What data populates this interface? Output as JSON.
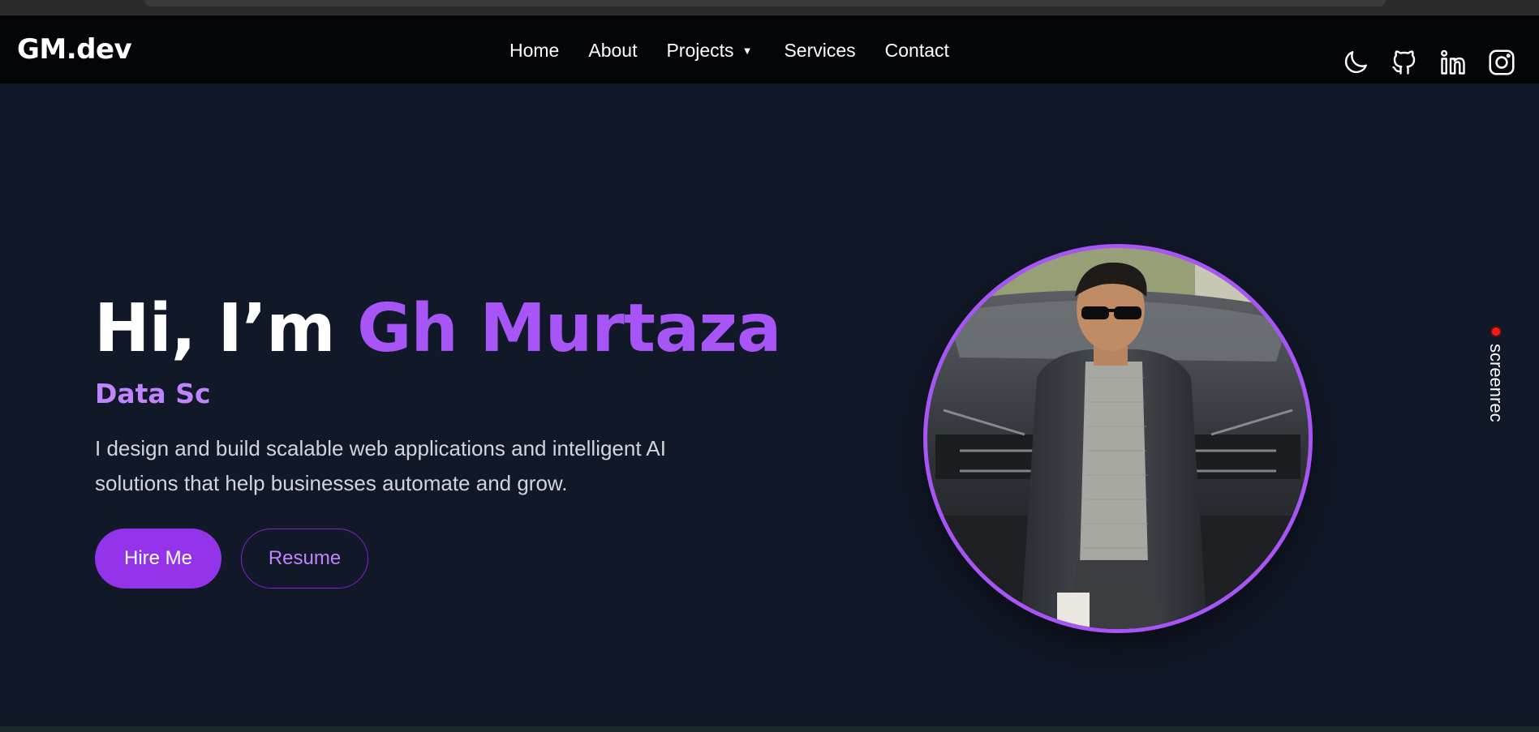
{
  "navbar": {
    "logo": "GM.dev",
    "links": [
      {
        "label": "Home"
      },
      {
        "label": "About"
      },
      {
        "label": "Projects",
        "has_dropdown": true,
        "caret": "▼"
      },
      {
        "label": "Services"
      },
      {
        "label": "Contact"
      }
    ],
    "icons": [
      "moon-icon",
      "github-icon",
      "linkedin-icon",
      "instagram-icon"
    ]
  },
  "hero": {
    "greeting": "Hi, I’m ",
    "name": "Gh Murtaza",
    "role": "Data Sc",
    "description": "I design and build scalable web applications and intelligent AI solutions that help businesses automate and grow.",
    "hire_label": "Hire Me",
    "resume_label": "Resume"
  },
  "overlay": {
    "screenrec_label": "screenrec"
  },
  "colors": {
    "background": "#111827",
    "navbar": "#030508",
    "accent": "#a855f7",
    "accent_light": "#c084fc",
    "button": "#9333ea"
  }
}
